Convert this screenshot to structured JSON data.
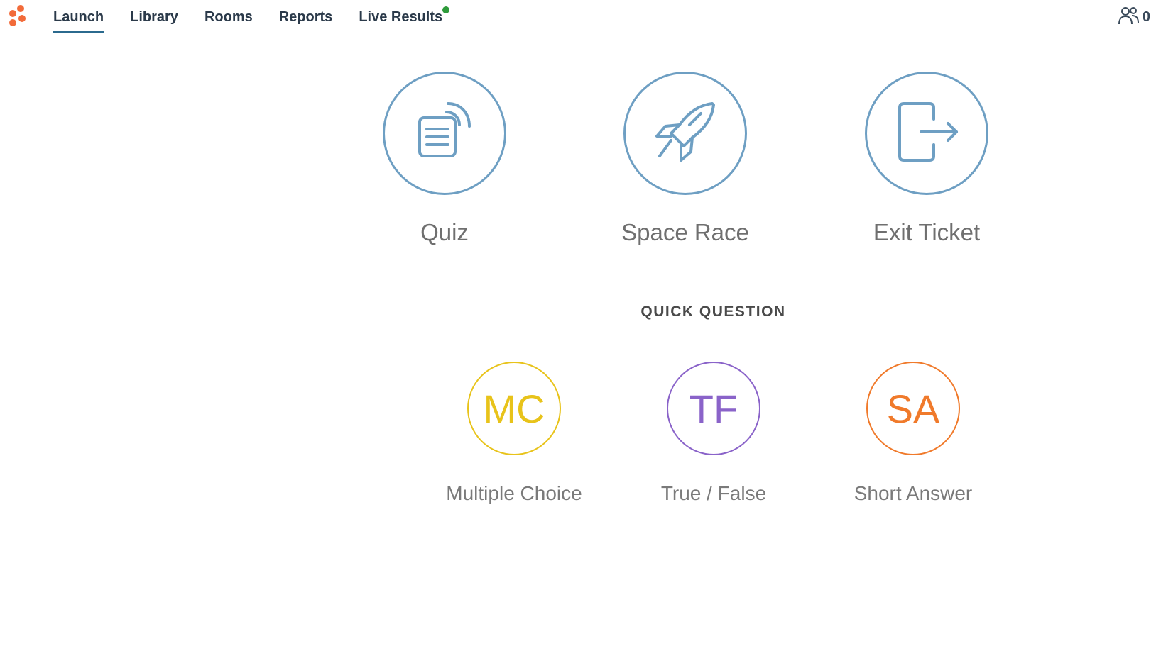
{
  "nav": {
    "items": [
      {
        "label": "Launch",
        "active": true
      },
      {
        "label": "Library",
        "active": false
      },
      {
        "label": "Rooms",
        "active": false
      },
      {
        "label": "Reports",
        "active": false
      },
      {
        "label": "Live Results",
        "active": false,
        "live_indicator": true
      }
    ],
    "user_count": "0",
    "user_icon": "users-icon",
    "logo_icon": "socrative-logo-icon"
  },
  "activities": [
    {
      "label": "Quiz",
      "icon": "quiz-icon"
    },
    {
      "label": "Space Race",
      "icon": "rocket-icon"
    },
    {
      "label": "Exit Ticket",
      "icon": "exit-ticket-icon"
    }
  ],
  "quick_question": {
    "title": "QUICK QUESTION",
    "items": [
      {
        "abbr": "MC",
        "label": "Multiple Choice",
        "color": "#e8c31a"
      },
      {
        "abbr": "TF",
        "label": "True / False",
        "color": "#8a63c9"
      },
      {
        "abbr": "SA",
        "label": "Short Answer",
        "color": "#f07a2b"
      }
    ]
  },
  "colors": {
    "accent": "#2b6a8e",
    "activity_circle": "#6e9fc3",
    "live_indicator": "#2e9b3a",
    "logo": "#f26b3a"
  }
}
